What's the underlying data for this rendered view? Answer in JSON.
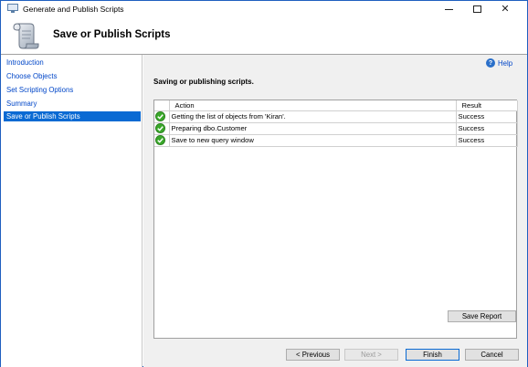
{
  "window": {
    "title": "Generate and Publish Scripts",
    "minimize_icon": "minimize-icon",
    "maximize_icon": "maximize-icon",
    "close_glyph": "✕"
  },
  "header": {
    "title": "Save or Publish Scripts",
    "icon": "scroll-icon"
  },
  "sidebar": {
    "items": [
      {
        "label": "Introduction",
        "selected": false
      },
      {
        "label": "Choose Objects",
        "selected": false
      },
      {
        "label": "Set Scripting Options",
        "selected": false
      },
      {
        "label": "Summary",
        "selected": false
      },
      {
        "label": "Save or Publish Scripts",
        "selected": true
      }
    ]
  },
  "main": {
    "help_label": "Help",
    "help_glyph": "?",
    "status_heading": "Saving or publishing scripts.",
    "grid": {
      "columns": [
        "",
        "Action",
        "Result"
      ],
      "rows": [
        {
          "status_icon": "success-check-icon",
          "action": "Getting the list of objects from 'Kiran'.",
          "result": "Success"
        },
        {
          "status_icon": "success-check-icon",
          "action": "Preparing dbo.Customer",
          "result": "Success"
        },
        {
          "status_icon": "success-check-icon",
          "action": "Save to new query window",
          "result": "Success"
        }
      ]
    },
    "save_report_label": "Save Report"
  },
  "footer": {
    "previous_label": "< Previous",
    "next_label": "Next >",
    "finish_label": "Finish",
    "cancel_label": "Cancel"
  },
  "colors": {
    "accent": "#0a6ad3",
    "link": "#0046c8",
    "success": "#3aa82a"
  }
}
